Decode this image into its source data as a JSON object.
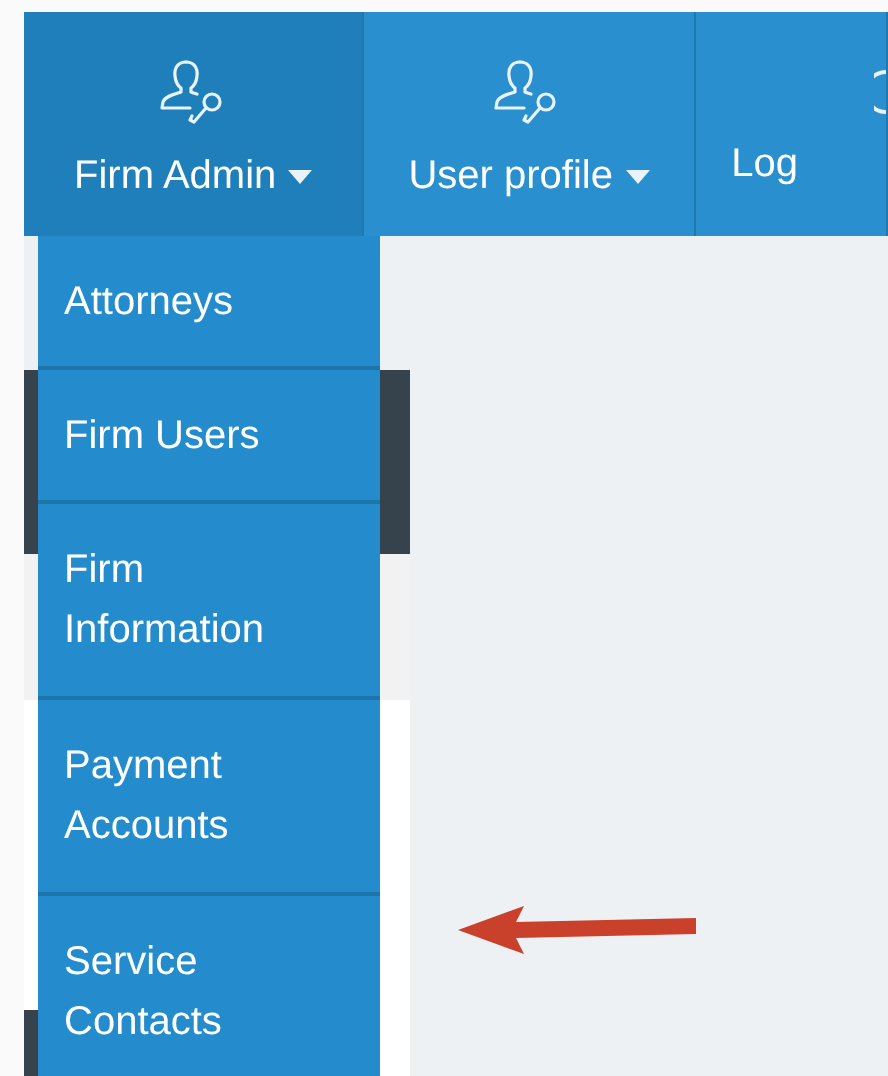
{
  "nav": [
    {
      "label": "Firm Admin",
      "kind": "user",
      "caret": true,
      "selected": true
    },
    {
      "label": "User profile",
      "kind": "user",
      "caret": true,
      "selected": false
    },
    {
      "label": "Log",
      "kind": "power",
      "caret": false,
      "selected": false
    }
  ],
  "dropdown": {
    "items": [
      {
        "label": "Attorneys"
      },
      {
        "label": "Firm Users"
      },
      {
        "label": "Firm Information"
      },
      {
        "label": "Payment Accounts"
      },
      {
        "label": "Service Contacts"
      }
    ]
  }
}
